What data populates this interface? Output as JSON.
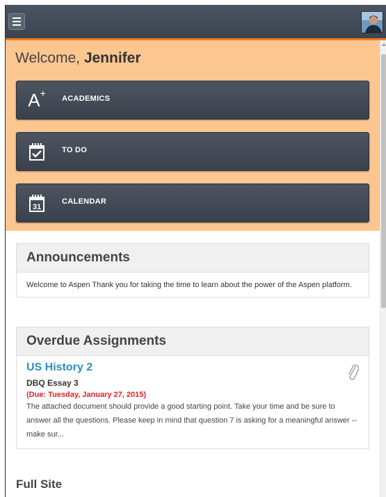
{
  "header": {
    "menu_icon": "hamburger-menu-icon",
    "avatar_icon": "user-avatar-photo"
  },
  "welcome": {
    "greeting": "Welcome,",
    "name": "Jennifer"
  },
  "nav_buttons": [
    {
      "label": "ACADEMICS",
      "icon": "a-plus-grade-icon"
    },
    {
      "label": "TO DO",
      "icon": "checklist-calendar-icon"
    },
    {
      "label": "CALENDAR",
      "icon": "calendar-31-icon"
    }
  ],
  "calendar_icon_day": "31",
  "announcements": {
    "title": "Announcements",
    "body": "Welcome to Aspen Thank you for taking the time to learn about the power of the Aspen platform."
  },
  "overdue": {
    "title": "Overdue Assignments",
    "course": "US History 2",
    "assignment": "DBQ Essay 3",
    "due": "(Due: Tuesday, January 27, 2015)",
    "description": "The attached document should provide a good starting point. Take your time and be sure to answer all the questions. Please keep in mind that question 7 is asking for a meaningful answer -- make sur...",
    "attachment_icon": "paperclip-icon"
  },
  "full_site": "Full Site",
  "colors": {
    "topbar": "#3c4450",
    "accent_orange": "#f07c1a",
    "hero_background": "#fcc690",
    "button_dark": "#434a55",
    "link_blue": "#2a8fc7",
    "due_red": "#e0202a"
  }
}
